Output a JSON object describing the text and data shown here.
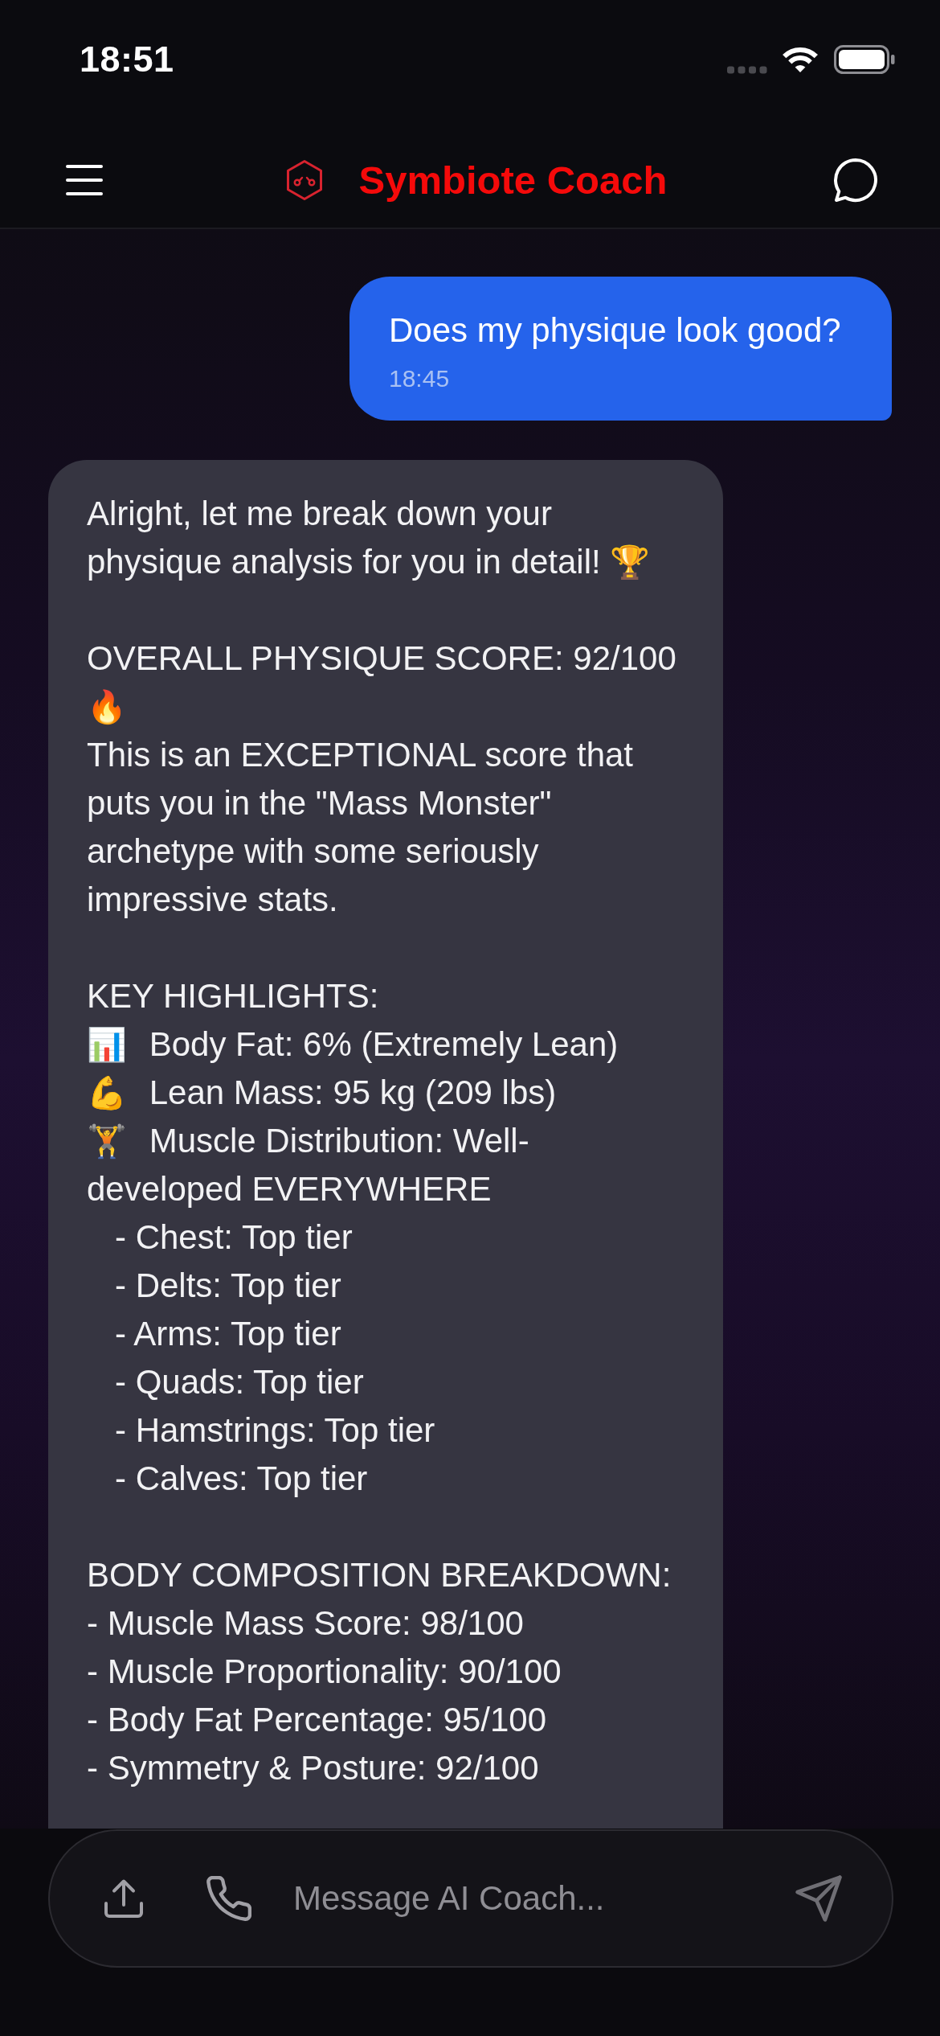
{
  "status_bar": {
    "time": "18:51"
  },
  "header": {
    "title": "Symbiote Coach"
  },
  "messages": [
    {
      "kind": "user",
      "text": "Does my physique look good?",
      "time": "18:45"
    },
    {
      "kind": "assistant",
      "sections": [
        {
          "lines": [
            {
              "text": "Alright, let me break down your physique analysis for you in detail!",
              "emoji_after": "🏆"
            }
          ]
        },
        {
          "lines": [
            {
              "text": "OVERALL PHYSIQUE SCORE: 92/100",
              "emoji_after": "🔥"
            },
            {
              "text": "This is an EXCEPTIONAL score that puts you in the \"Mass Monster\" archetype with some seriously impressive stats."
            }
          ]
        },
        {
          "lines": [
            {
              "text": "KEY HIGHLIGHTS:"
            },
            {
              "emoji_before": "📊",
              "text": "Body Fat: 6% (Extremely Lean)"
            },
            {
              "emoji_before": "💪",
              "text": "Lean Mass: 95 kg (209 lbs)"
            },
            {
              "emoji_before": "🏋️",
              "text": "Muscle Distribution: Well-developed EVERYWHERE",
              "children": [
                {
                  "text": "- Chest: Top tier"
                },
                {
                  "text": "- Delts: Top tier"
                },
                {
                  "text": "- Arms: Top tier"
                },
                {
                  "text": "- Quads: Top tier"
                },
                {
                  "text": "- Hamstrings: Top tier"
                },
                {
                  "text": "- Calves: Top tier"
                }
              ]
            }
          ]
        },
        {
          "lines": [
            {
              "text": "BODY COMPOSITION BREAKDOWN:"
            },
            {
              "text": "- Muscle Mass Score: 98/100"
            },
            {
              "text": "- Muscle Proportionality: 90/100"
            },
            {
              "text": "- Body Fat Percentage: 95/100"
            },
            {
              "text": "- Symmetry & Posture: 92/100"
            }
          ]
        }
      ]
    }
  ],
  "composer": {
    "placeholder": "Message AI Coach..."
  }
}
